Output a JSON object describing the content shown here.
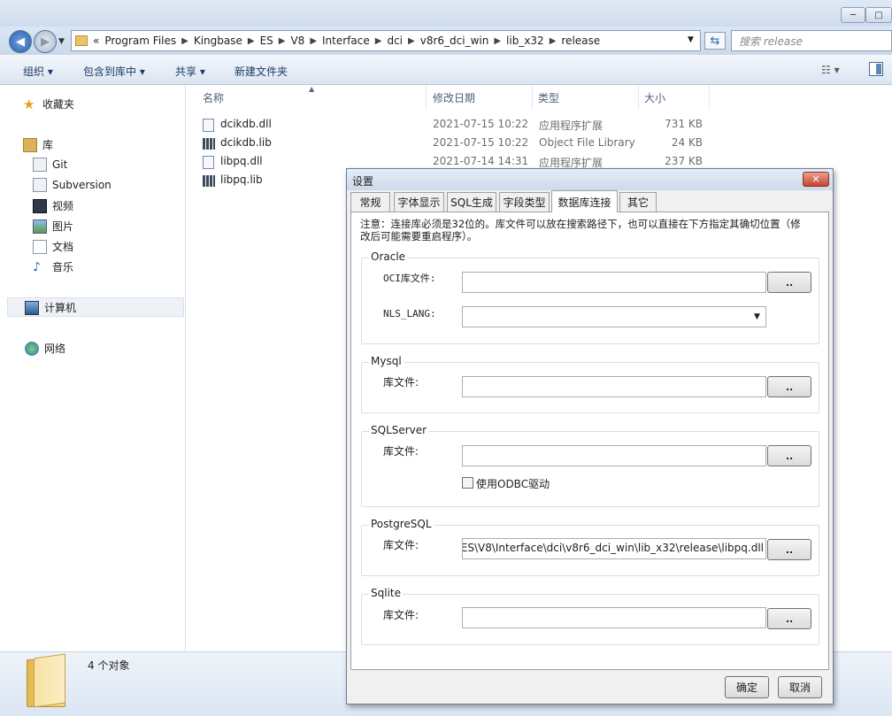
{
  "window": {
    "minimize_glyph": "─",
    "maximize_glyph": "□",
    "close_glyph": "✕"
  },
  "address": {
    "prefix": "«",
    "crumbs": [
      "Program Files",
      "Kingbase",
      "ES",
      "V8",
      "Interface",
      "dci",
      "v8r6_dci_win",
      "lib_x32",
      "release"
    ],
    "search_placeholder": "搜索 release"
  },
  "toolbar": {
    "organize": "组织 ▾",
    "include_in_library": "包含到库中 ▾",
    "share": "共享 ▾",
    "new_folder": "新建文件夹"
  },
  "nav": {
    "favorites": "收藏夹",
    "libraries": "库",
    "lib_items": [
      "Git",
      "Subversion",
      "视频",
      "图片",
      "文档",
      "音乐"
    ],
    "computer": "计算机",
    "network": "网络"
  },
  "columns": {
    "name": "名称",
    "modified": "修改日期",
    "type": "类型",
    "size": "大小"
  },
  "files": [
    {
      "name": "dcikdb.dll",
      "modified": "2021-07-15 10:22",
      "type": "应用程序扩展",
      "size": "731 KB"
    },
    {
      "name": "dcikdb.lib",
      "modified": "2021-07-15 10:22",
      "type": "Object File Library",
      "size": "24 KB"
    },
    {
      "name": "libpq.dll",
      "modified": "2021-07-14 14:31",
      "type": "应用程序扩展",
      "size": "237 KB"
    },
    {
      "name": "libpq.lib",
      "modified": "",
      "type": "",
      "size": ""
    }
  ],
  "status": {
    "count": "4 个对象"
  },
  "dialog": {
    "title": "设置",
    "tabs": [
      "常规",
      "字体显示",
      "SQL生成",
      "字段类型",
      "数据库连接",
      "其它"
    ],
    "active_tab": "数据库连接",
    "note_line1": "注意：连接库必须是32位的。库文件可以放在搜索路径下，也可以直接在下方指定其确切位置（修",
    "note_line2": "改后可能需要重启程序）。",
    "browse_label": "..",
    "oracle": {
      "legend": "Oracle",
      "oci_label": "OCI库文件:",
      "oci_value": "",
      "nls_label": "NLS_LANG:",
      "nls_value": ""
    },
    "mysql": {
      "legend": "Mysql",
      "lib_label": "库文件:",
      "lib_value": ""
    },
    "sqlserver": {
      "legend": "SQLServer",
      "lib_label": "库文件:",
      "lib_value": "",
      "odbc_label": "使用ODBC驱动",
      "odbc_checked": false
    },
    "postgresql": {
      "legend": "PostgreSQL",
      "lib_label": "库文件:",
      "lib_value": ":\\ES\\V8\\Interface\\dci\\v8r6_dci_win\\lib_x32\\release\\libpq.dll"
    },
    "sqlite": {
      "legend": "Sqlite",
      "lib_label": "库文件:",
      "lib_value": ""
    },
    "ok": "确定",
    "cancel": "取消"
  }
}
